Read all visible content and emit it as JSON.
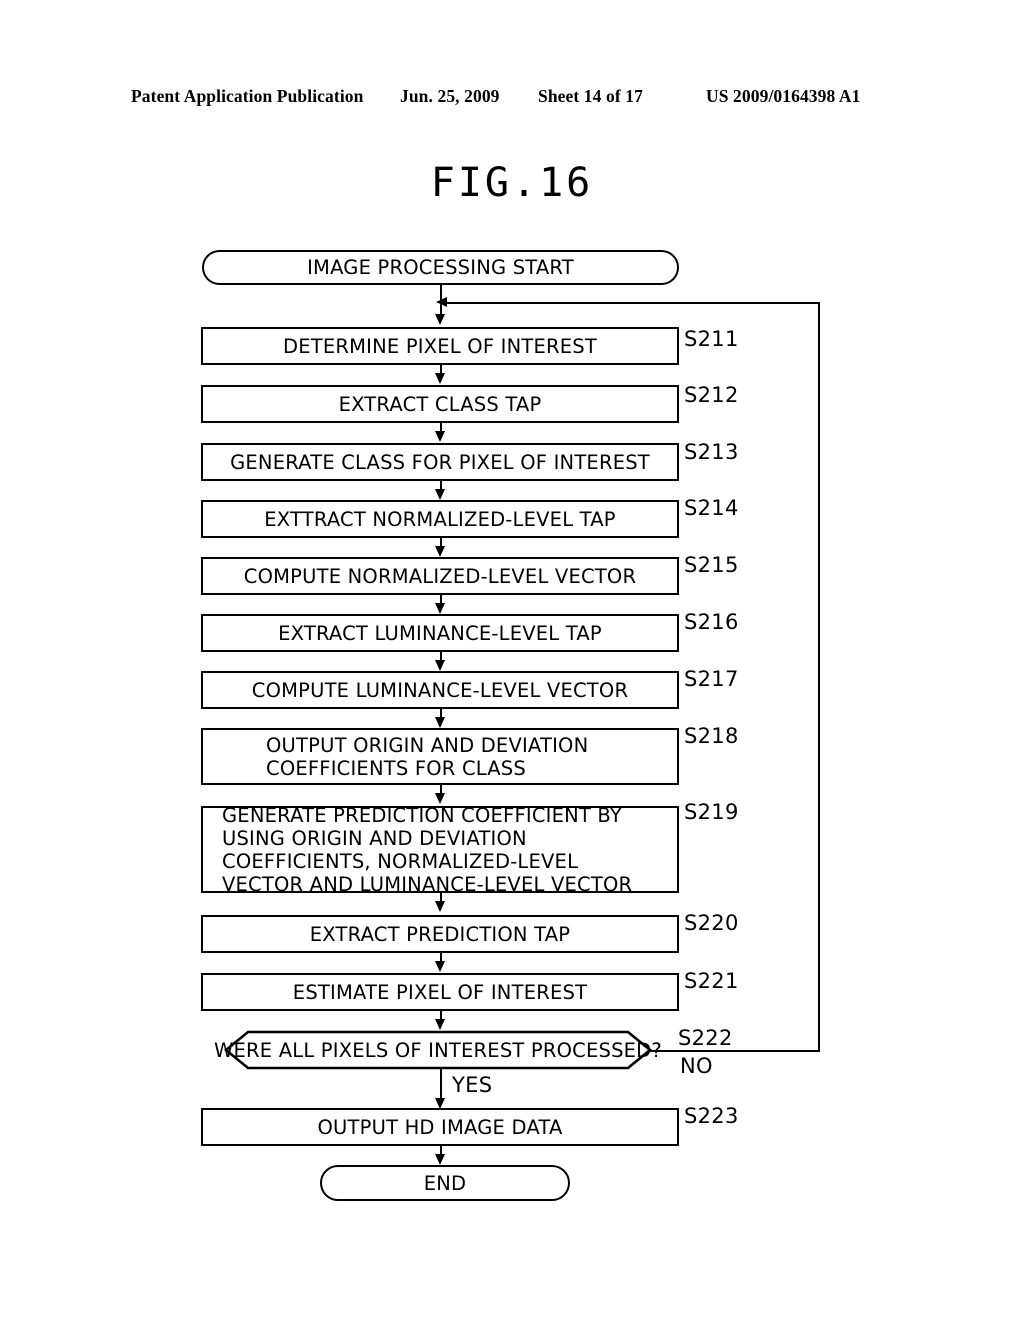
{
  "header": {
    "publication": "Patent Application Publication",
    "date": "Jun. 25, 2009",
    "sheet": "Sheet 14 of 17",
    "number": "US 2009/0164398 A1"
  },
  "figure": {
    "title": "FIG.16"
  },
  "flowchart": {
    "start": {
      "label": "IMAGE PROCESSING START"
    },
    "end": {
      "label": "END"
    },
    "steps": [
      {
        "id": "S211",
        "label": "DETERMINE PIXEL OF INTEREST"
      },
      {
        "id": "S212",
        "label": "EXTRACT CLASS TAP"
      },
      {
        "id": "S213",
        "label": "GENERATE CLASS FOR PIXEL OF INTEREST"
      },
      {
        "id": "S214",
        "label": "EXTTRACT NORMALIZED-LEVEL TAP"
      },
      {
        "id": "S215",
        "label": "COMPUTE NORMALIZED-LEVEL VECTOR"
      },
      {
        "id": "S216",
        "label": "EXTRACT LUMINANCE-LEVEL TAP"
      },
      {
        "id": "S217",
        "label": "COMPUTE LUMINANCE-LEVEL VECTOR"
      },
      {
        "id": "S218",
        "label": "OUTPUT ORIGIN AND DEVIATION\nCOEFFICIENTS FOR CLASS"
      },
      {
        "id": "S219",
        "label": "GENERATE PREDICTION COEFFICIENT BY\nUSING ORIGIN AND DEVIATION\nCOEFFICIENTS, NORMALIZED-LEVEL\nVECTOR AND LUMINANCE-LEVEL VECTOR"
      },
      {
        "id": "S220",
        "label": "EXTRACT PREDICTION TAP"
      },
      {
        "id": "S221",
        "label": "ESTIMATE PIXEL OF INTEREST"
      },
      {
        "id": "S222",
        "label": "WERE ALL PIXELS OF INTEREST PROCESSED?"
      },
      {
        "id": "S223",
        "label": "OUTPUT HD IMAGE DATA"
      }
    ],
    "branches": {
      "yes": "YES",
      "no": "NO"
    }
  }
}
